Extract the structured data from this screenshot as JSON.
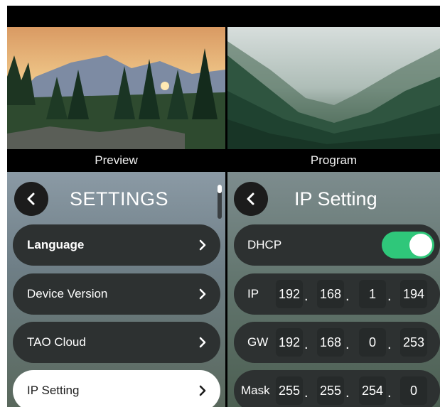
{
  "monitors": {
    "preview_label": "Preview",
    "program_label": "Program"
  },
  "settings": {
    "title": "SETTINGS",
    "items": [
      {
        "label": "Language"
      },
      {
        "label": "Device Version"
      },
      {
        "label": "TAO Cloud"
      },
      {
        "label": "IP Setting"
      }
    ]
  },
  "ip_setting": {
    "title": "IP Setting",
    "dhcp": {
      "label": "DHCP",
      "enabled": true
    },
    "ip": {
      "label": "IP",
      "octets": [
        "192",
        "168",
        "1",
        "194"
      ]
    },
    "gw": {
      "label": "GW",
      "octets": [
        "192",
        "168",
        "0",
        "253"
      ]
    },
    "mask": {
      "label": "Mask",
      "octets": [
        "255",
        "255",
        "254",
        "0"
      ]
    },
    "separator": "."
  },
  "colors": {
    "toggle_on": "#2fc77a",
    "row_bg": "#2d3131",
    "active_item_bg": "#ffffff"
  }
}
